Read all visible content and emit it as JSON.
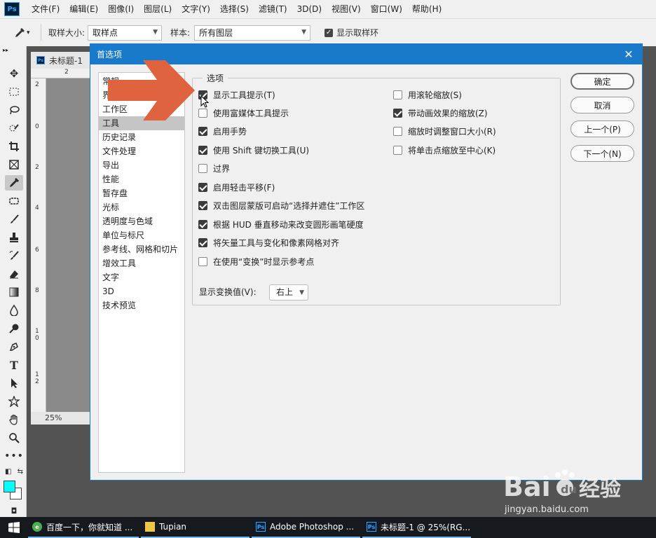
{
  "menubar": {
    "app_icon": "Ps",
    "items": [
      "文件(F)",
      "编辑(E)",
      "图像(I)",
      "图层(L)",
      "文字(Y)",
      "选择(S)",
      "滤镜(T)",
      "3D(D)",
      "视图(V)",
      "窗口(W)",
      "帮助(H)"
    ]
  },
  "options_bar": {
    "sample_size_label": "取样大小:",
    "sample_size_value": "取样点",
    "sample_label": "样本:",
    "sample_value": "所有图层",
    "show_ring_label": "显示取样环",
    "show_ring_checked": true
  },
  "document": {
    "tab_title": "未标题-1",
    "zoom": "25%",
    "ruler_h": "2",
    "ruler_v": [
      "2",
      "0",
      "2",
      "4",
      "6",
      "8",
      "1\n0",
      "1\n2"
    ]
  },
  "dialog": {
    "title": "首选项",
    "categories": [
      "常规",
      "界面",
      "工作区",
      "工具",
      "历史记录",
      "文件处理",
      "导出",
      "性能",
      "暂存盘",
      "光标",
      "透明度与色域",
      "单位与标尺",
      "参考线、网格和切片",
      "增效工具",
      "文字",
      "3D",
      "技术预览"
    ],
    "selected_category": "工具",
    "group_title": "选项",
    "left_options": [
      {
        "label": "显示工具提示(T)",
        "checked": true
      },
      {
        "label": "使用富媒体工具提示",
        "checked": false
      },
      {
        "label": "启用手势",
        "checked": true
      },
      {
        "label": "使用 Shift 键切换工具(U)",
        "checked": true
      },
      {
        "label": "过界",
        "checked": false
      },
      {
        "label": "启用轻击平移(F)",
        "checked": true
      },
      {
        "label": "双击图层蒙版可启动“选择并遮住”工作区",
        "checked": true
      },
      {
        "label": "根据 HUD 垂直移动来改变圆形画笔硬度",
        "checked": true
      },
      {
        "label": "将矢量工具与变化和像素网格对齐",
        "checked": true
      },
      {
        "label": "在使用“变换”时显示参考点",
        "checked": false
      }
    ],
    "right_options": [
      {
        "label": "用滚轮缩放(S)",
        "checked": false
      },
      {
        "label": "带动画效果的缩放(Z)",
        "checked": true
      },
      {
        "label": "缩放时调整窗口大小(R)",
        "checked": false
      },
      {
        "label": "将单击点缩放至中心(K)",
        "checked": false
      }
    ],
    "transform_label": "显示变换值(V):",
    "transform_value": "右上",
    "buttons": {
      "ok": "确定",
      "cancel": "取消",
      "prev": "上一个(P)",
      "next": "下一个(N)"
    }
  },
  "taskbar": {
    "items": [
      {
        "label": "百度一下，你就知道 ...",
        "icon": "browser-icon"
      },
      {
        "label": "Tupian",
        "icon": "folder-icon"
      },
      {
        "label": "Adobe Photoshop ...",
        "icon": "photoshop-icon"
      },
      {
        "label": "未标题-1 @ 25%(RG...",
        "icon": "photoshop-icon"
      }
    ]
  },
  "watermark": {
    "url": "jingyan.baidu.com"
  },
  "colors": {
    "dialog_title": "#1979ca",
    "arrow": "#e0633f",
    "foreground": "#00ffff",
    "background": "#ffffff"
  }
}
